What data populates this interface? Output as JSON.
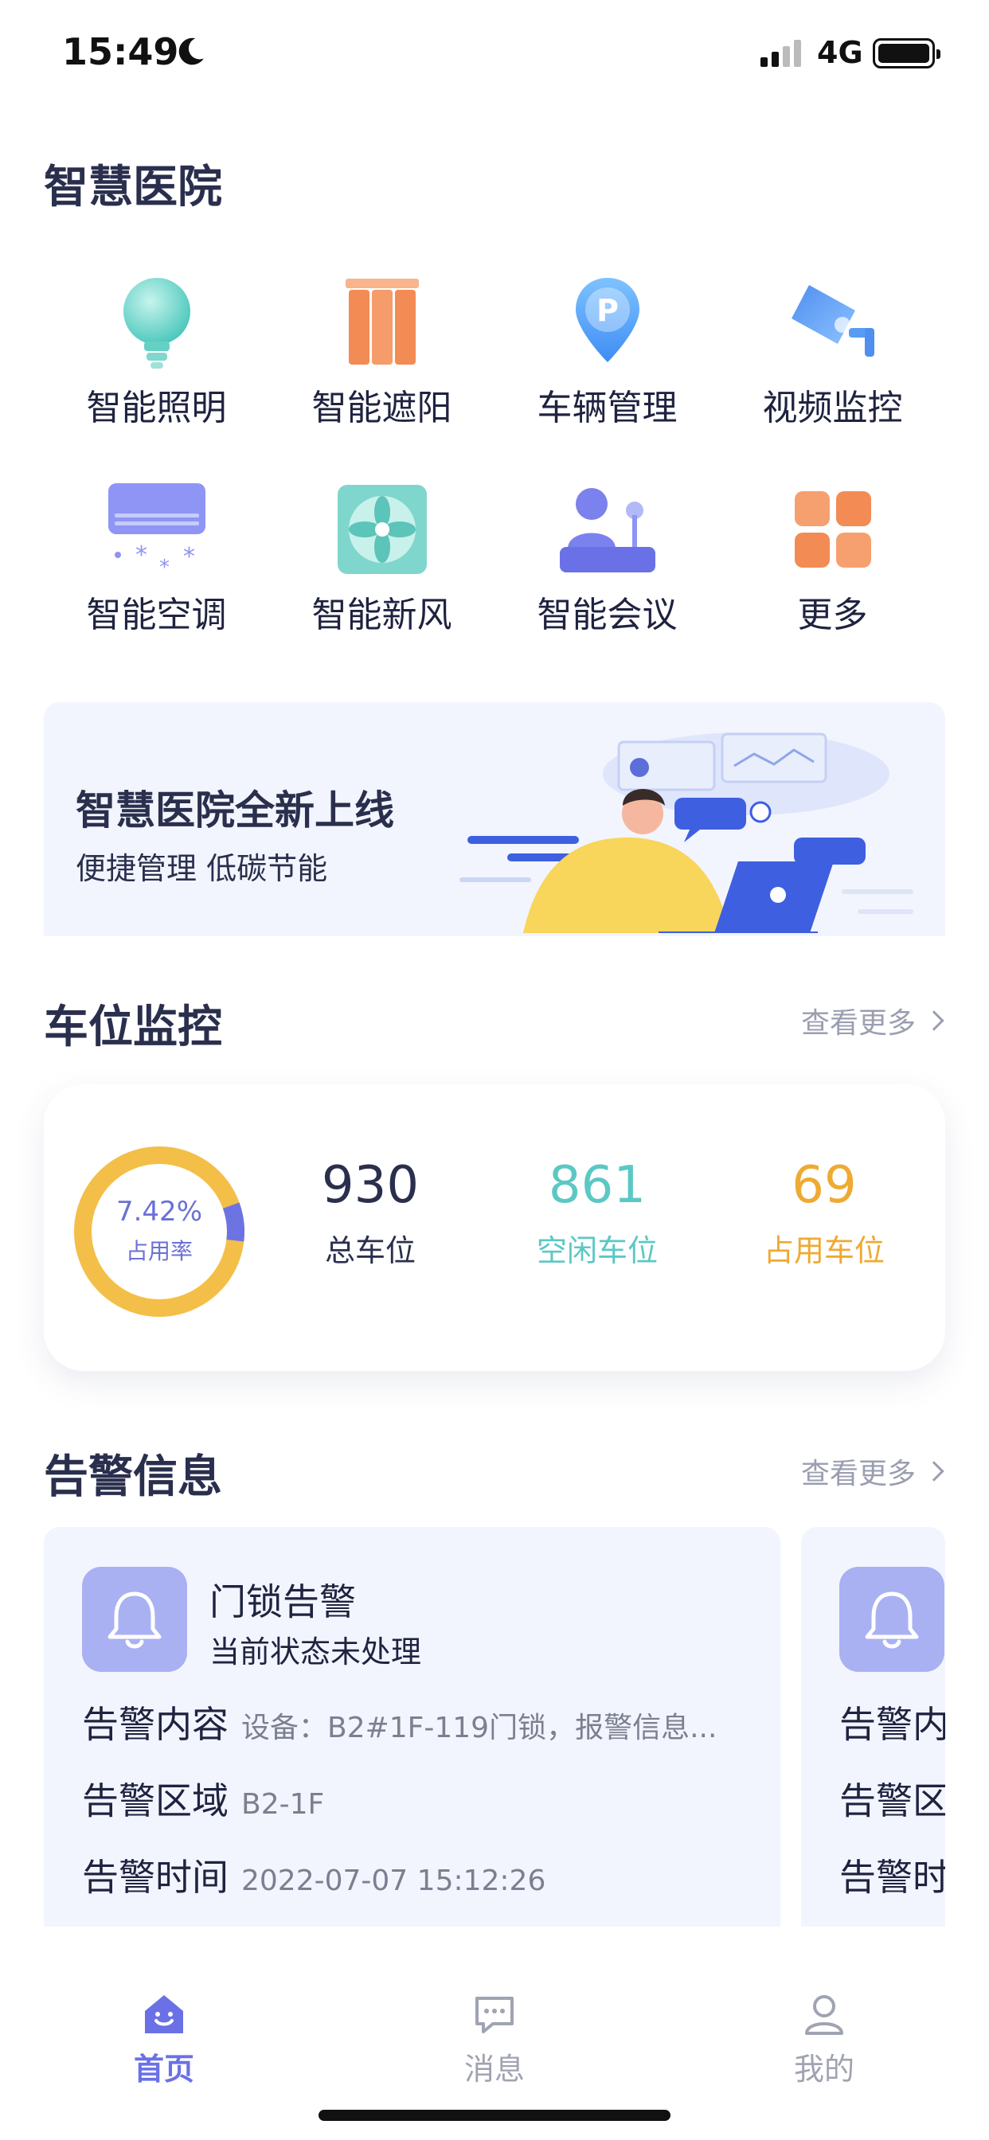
{
  "status_bar": {
    "time": "15:49",
    "network": "4G"
  },
  "app": {
    "title": "智慧医院"
  },
  "grid_items": [
    {
      "label": "智能照明",
      "icon": "bulb-icon"
    },
    {
      "label": "智能遮阳",
      "icon": "curtain-icon"
    },
    {
      "label": "车辆管理",
      "icon": "parking-pin-icon"
    },
    {
      "label": "视频监控",
      "icon": "camera-icon"
    },
    {
      "label": "智能空调",
      "icon": "air-conditioner-icon"
    },
    {
      "label": "智能新风",
      "icon": "fan-icon"
    },
    {
      "label": "智能会议",
      "icon": "meeting-icon"
    },
    {
      "label": "更多",
      "icon": "more-grid-icon"
    }
  ],
  "banner": {
    "title": "智慧医院全新上线",
    "subtitle": "便捷管理 低碳节能"
  },
  "parking": {
    "title": "车位监控",
    "more": "查看更多",
    "occupancy_rate": "7.42%",
    "occupancy_fraction": 0.0742,
    "rate_label": "占用率",
    "total": {
      "value": "930",
      "label": "总车位"
    },
    "free": {
      "value": "861",
      "label": "空闲车位"
    },
    "used": {
      "value": "69",
      "label": "占用车位"
    },
    "colors": {
      "free": "#f4bf48",
      "used": "#6c73e3",
      "free_text": "#5cc8c4",
      "used_text": "#eeaa32"
    }
  },
  "alarms": {
    "title": "告警信息",
    "more": "查看更多",
    "items": [
      {
        "name": "门锁告警",
        "state": "当前状态未处理",
        "content_key": "告警内容",
        "content_value": "设备：B2#1F-119门锁，报警信息...",
        "area_key": "告警区域",
        "area_value": "B2-1F",
        "time_key": "告警时间",
        "time_value": "2022-07-07 15:12:26"
      },
      {
        "content_key": "告警内容",
        "area_key": "告警区域",
        "time_key": "告警时间"
      }
    ]
  },
  "tabbar": {
    "items": [
      {
        "label": "首页",
        "active": true
      },
      {
        "label": "消息",
        "active": false
      },
      {
        "label": "我的",
        "active": false
      }
    ],
    "active_color": "#6a71e6",
    "inactive_color": "#a0a3b1"
  }
}
